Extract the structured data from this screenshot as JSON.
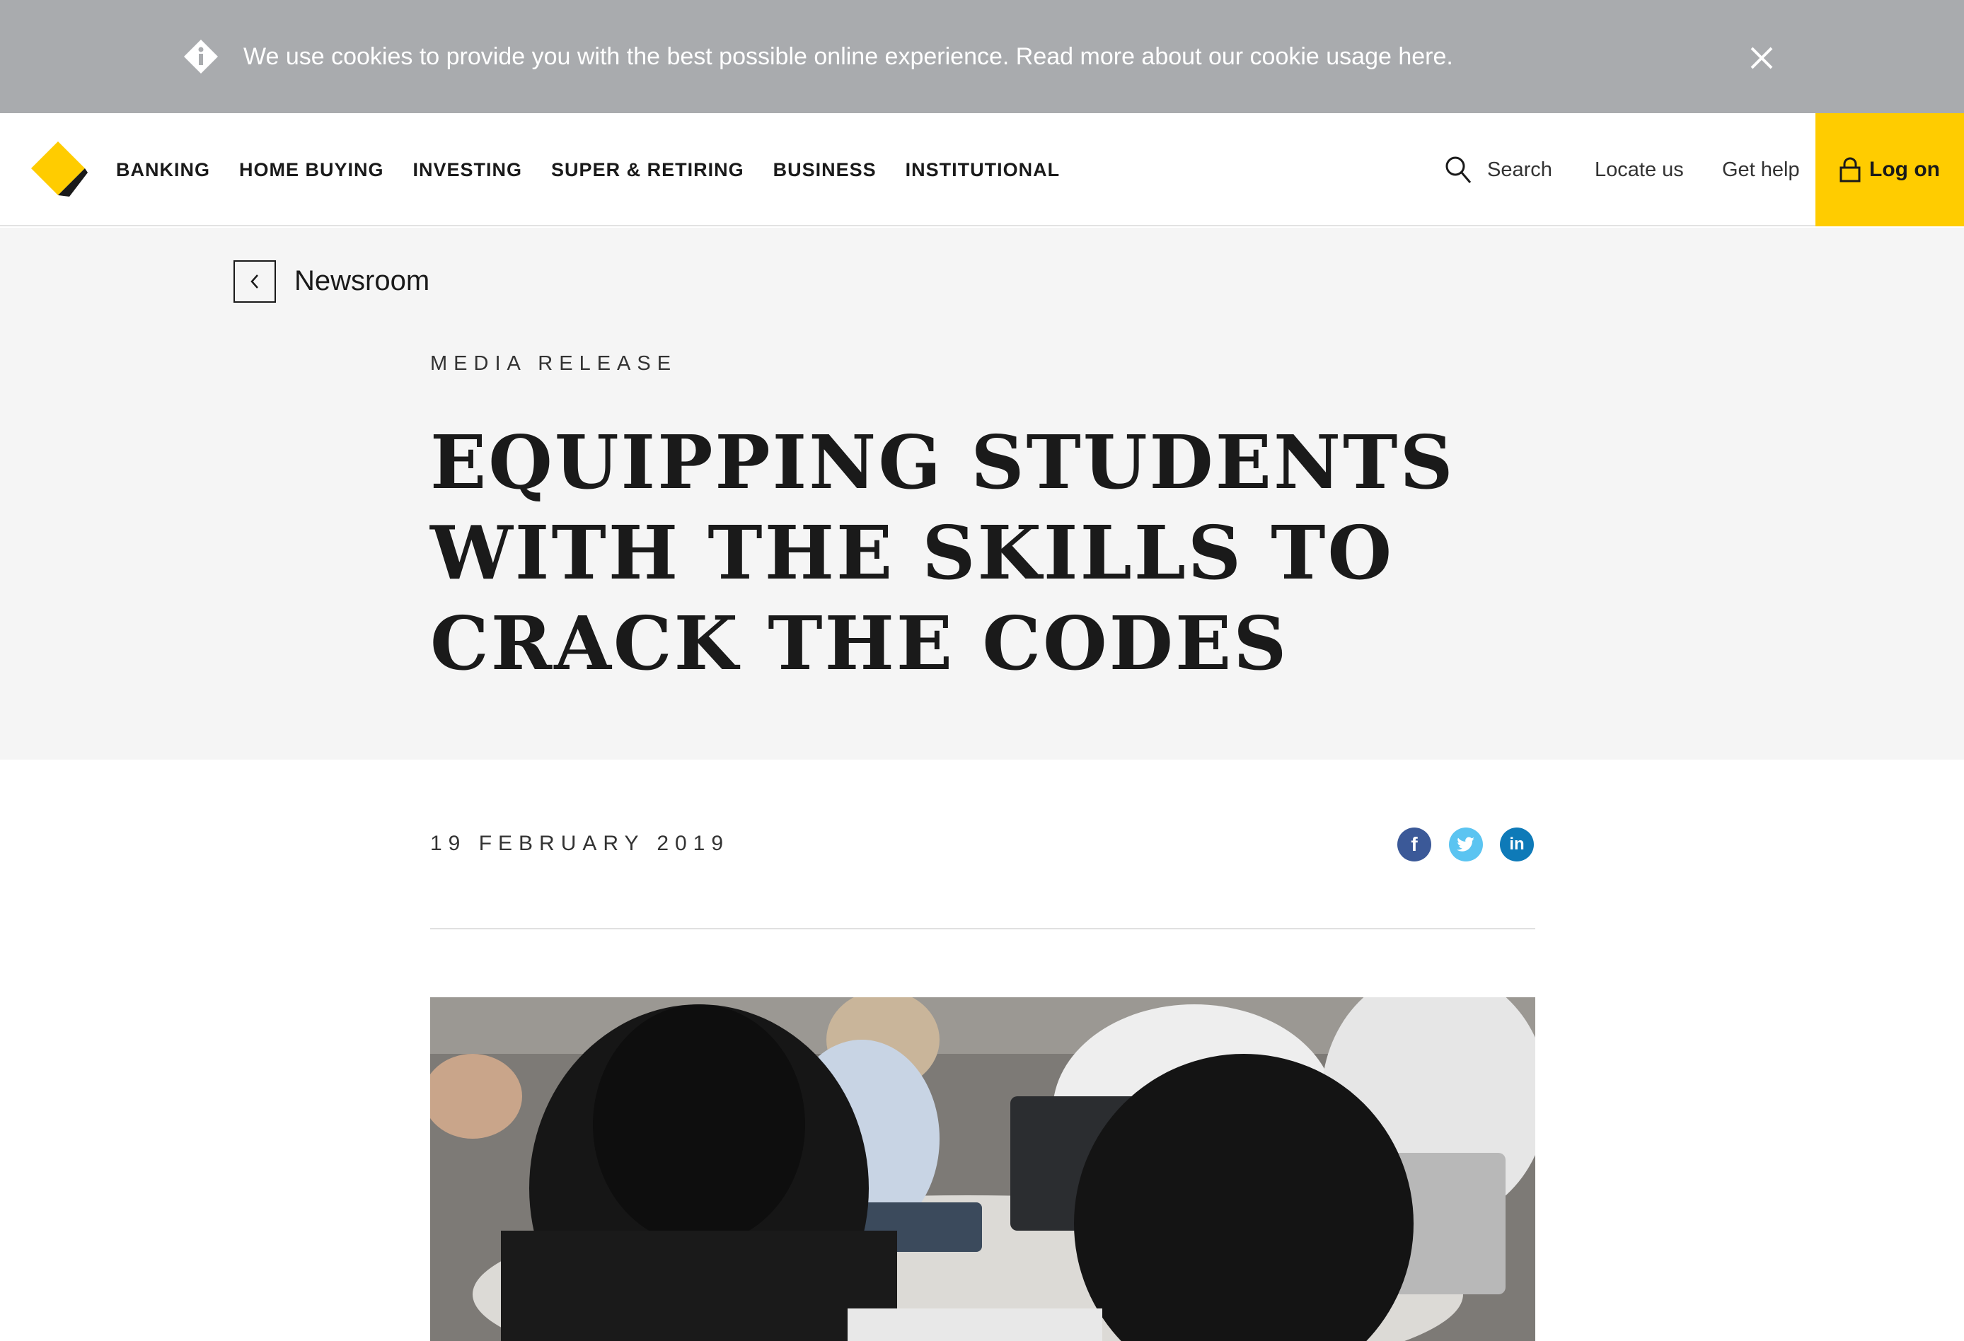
{
  "cookie": {
    "message": "We use cookies to provide you with the best possible online experience. ",
    "link": "Read more about our cookie usage here",
    "suffix": "."
  },
  "nav": {
    "items": [
      "BANKING",
      "HOME BUYING",
      "INVESTING",
      "SUPER & RETIRING",
      "BUSINESS",
      "INSTITUTIONAL"
    ],
    "search": "Search",
    "locate": "Locate us",
    "help": "Get help",
    "logon": "Log on"
  },
  "breadcrumb": {
    "back": "Newsroom"
  },
  "article": {
    "kicker": "MEDIA RELEASE",
    "title": "EQUIPPING STUDENTS WITH THE SKILLS TO CRACK THE CODES",
    "date": "19 FEBRUARY 2019"
  },
  "colors": {
    "brand_yellow": "#ffcc00",
    "cookie_bg": "#a9abae",
    "hero_bg": "#f5f5f5",
    "facebook": "#3b5998",
    "twitter": "#5bc4f1",
    "linkedin": "#0e7ab8"
  },
  "icons": [
    "info-icon",
    "close-icon",
    "logo-icon",
    "search-icon",
    "lock-icon",
    "chevron-left-icon",
    "facebook-icon",
    "twitter-icon",
    "linkedin-icon"
  ]
}
